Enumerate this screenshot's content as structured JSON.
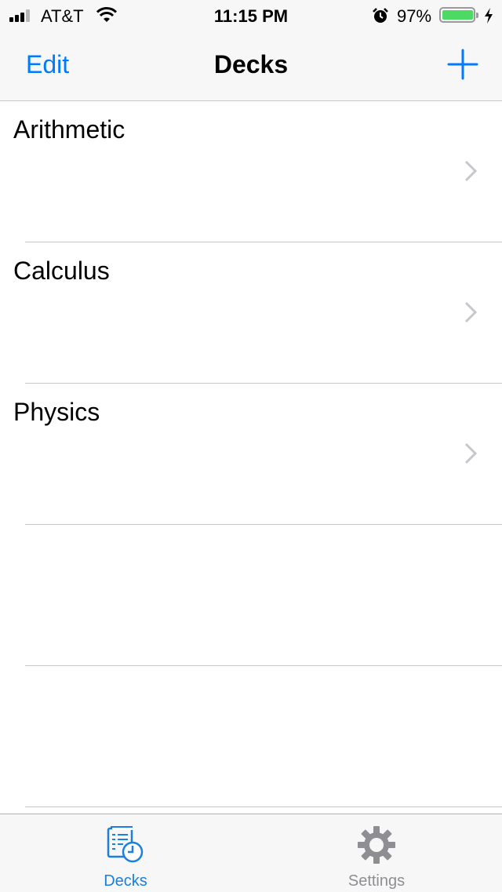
{
  "status_bar": {
    "carrier": "AT&T",
    "time": "11:15 PM",
    "battery_percent": "97%",
    "battery_level": 0.97,
    "signal_bars": 3,
    "icons": [
      "signal-icon",
      "wifi-icon",
      "alarm-icon",
      "battery-icon",
      "charging-icon"
    ]
  },
  "nav": {
    "edit_label": "Edit",
    "title": "Decks",
    "add_icon": "plus-icon"
  },
  "decks": [
    {
      "name": "Arithmetic"
    },
    {
      "name": "Calculus"
    },
    {
      "name": "Physics"
    }
  ],
  "tabs": [
    {
      "label": "Decks",
      "icon": "decks-icon",
      "active": true
    },
    {
      "label": "Settings",
      "icon": "gear-icon",
      "active": false
    }
  ],
  "colors": {
    "accent": "#007aff",
    "active_tab": "#1a7fe0",
    "inactive_tab": "#8e8e93",
    "battery_fill": "#4cd964"
  }
}
